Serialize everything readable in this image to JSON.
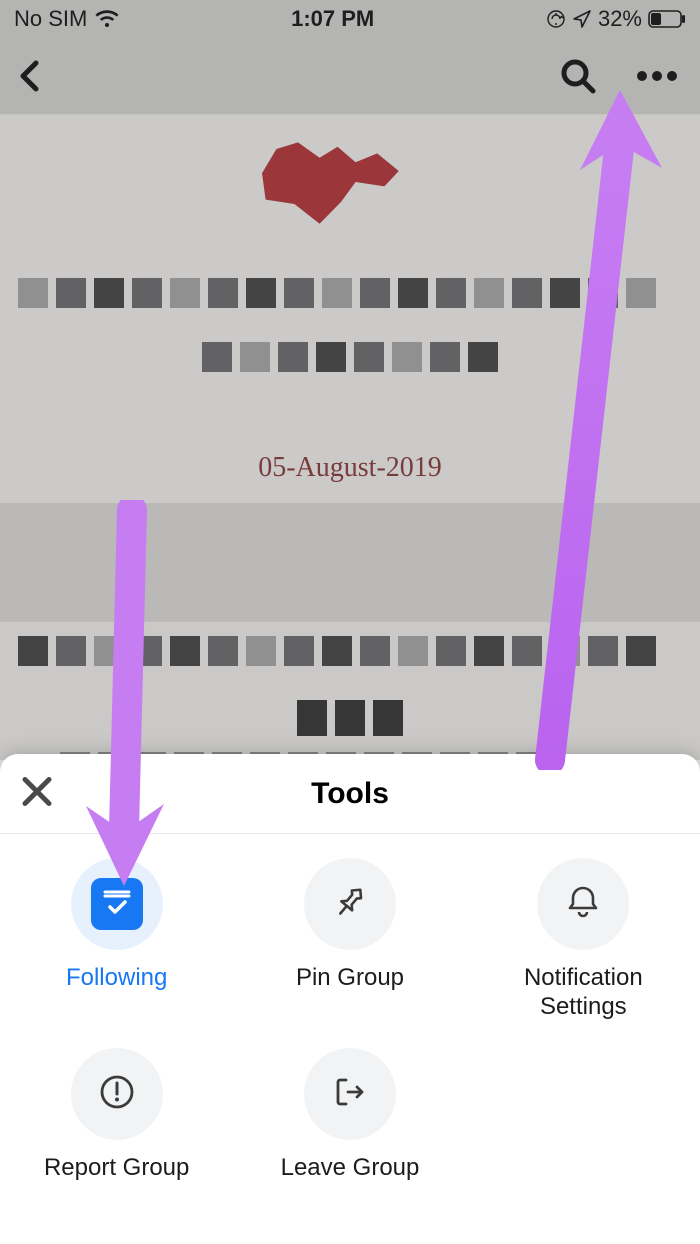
{
  "status": {
    "carrier": "No SIM",
    "time": "1:07 PM",
    "battery_pct": "32%"
  },
  "cover": {
    "caption": "05-August-2019"
  },
  "sheet": {
    "title": "Tools",
    "tools": [
      {
        "label": "Following"
      },
      {
        "label": "Pin Group"
      },
      {
        "label": "Notification Settings"
      },
      {
        "label": "Report Group"
      },
      {
        "label": "Leave Group"
      }
    ]
  }
}
